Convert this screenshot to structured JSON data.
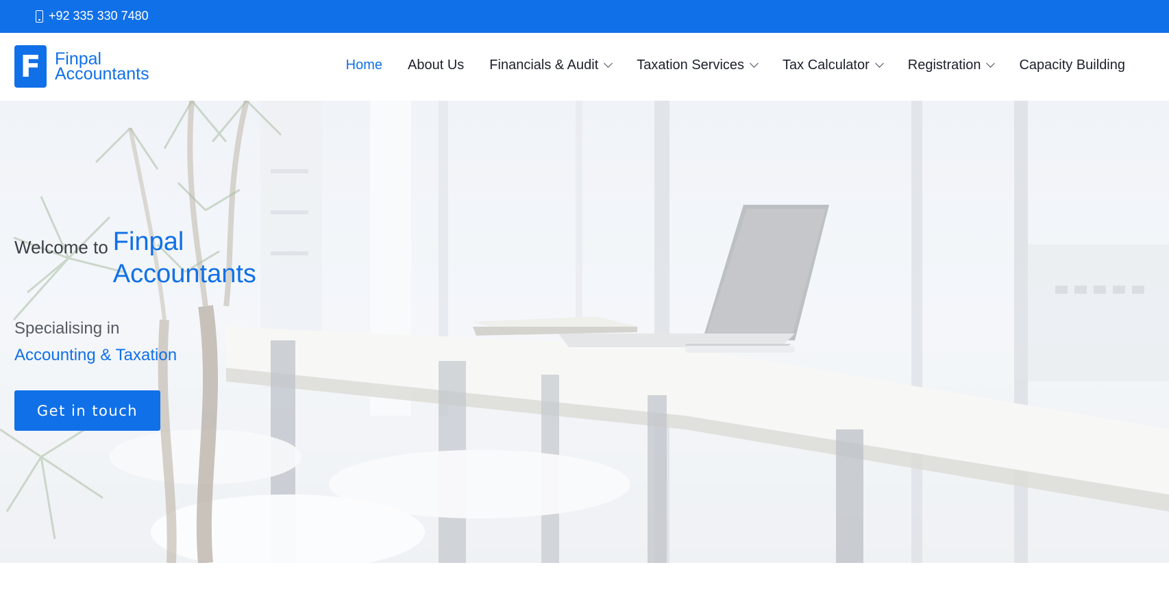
{
  "topbar": {
    "phone_icon": "mobile-phone-icon",
    "phone": "+92 335 330 7480"
  },
  "brand": {
    "mark": "F",
    "name_line1": "Finpal",
    "name_line2": "Accountants"
  },
  "nav": {
    "items": [
      {
        "label": "Home",
        "active": true
      },
      {
        "label": "About Us"
      },
      {
        "label": "Financials & Audit",
        "dropdown": true
      },
      {
        "label": "Taxation Services",
        "dropdown": true
      },
      {
        "label": "Tax Calculator",
        "dropdown": true
      },
      {
        "label": "Registration",
        "dropdown": true
      },
      {
        "label": "Capacity Building"
      }
    ]
  },
  "hero": {
    "welcome_prefix": "Welcome to",
    "brand_line1": "Finpal",
    "brand_line2": "Accountants",
    "specialising_label": "Specialising in",
    "specialising_value": "Accounting & Taxation",
    "cta_label": "Get in touch"
  },
  "colors": {
    "accent": "#1070e8",
    "text_dark": "#1b1f2a"
  }
}
